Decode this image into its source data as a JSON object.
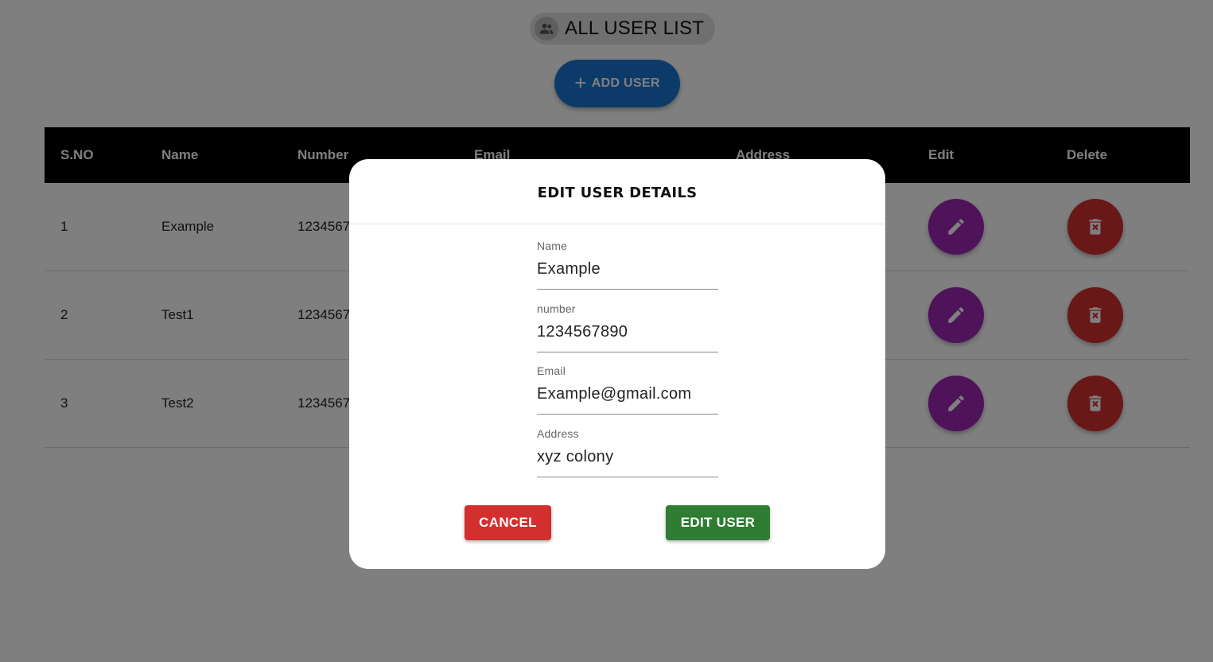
{
  "header": {
    "title": "ALL USER LIST",
    "title_icon": "group-icon"
  },
  "add_button": {
    "icon": "plus-icon",
    "label": "ADD USER"
  },
  "table": {
    "columns": [
      "S.NO",
      "Name",
      "Number",
      "Email",
      "Address",
      "Edit",
      "Delete"
    ],
    "rows": [
      {
        "sno": "1",
        "name": "Example",
        "number": "1234567"
      },
      {
        "sno": "2",
        "name": "Test1",
        "number": "1234567"
      },
      {
        "sno": "3",
        "name": "Test2",
        "number": "1234567"
      }
    ],
    "edit_icon": "pencil-icon",
    "delete_icon": "trash-icon"
  },
  "dialog": {
    "title": "EDIT USER DETAILS",
    "fields": {
      "name": {
        "label": "Name",
        "value": "Example"
      },
      "number": {
        "label": "number",
        "value": "1234567890"
      },
      "email": {
        "label": "Email",
        "value": "Example@gmail.com"
      },
      "address": {
        "label": "Address",
        "value": "xyz colony"
      }
    },
    "cancel_label": "CANCEL",
    "submit_label": "EDIT USER"
  },
  "colors": {
    "primary": "#1976d2",
    "edit_purple": "#9c27b0",
    "delete_red": "#d32f2f",
    "submit_green": "#2e7d32",
    "header_black": "#000000"
  }
}
